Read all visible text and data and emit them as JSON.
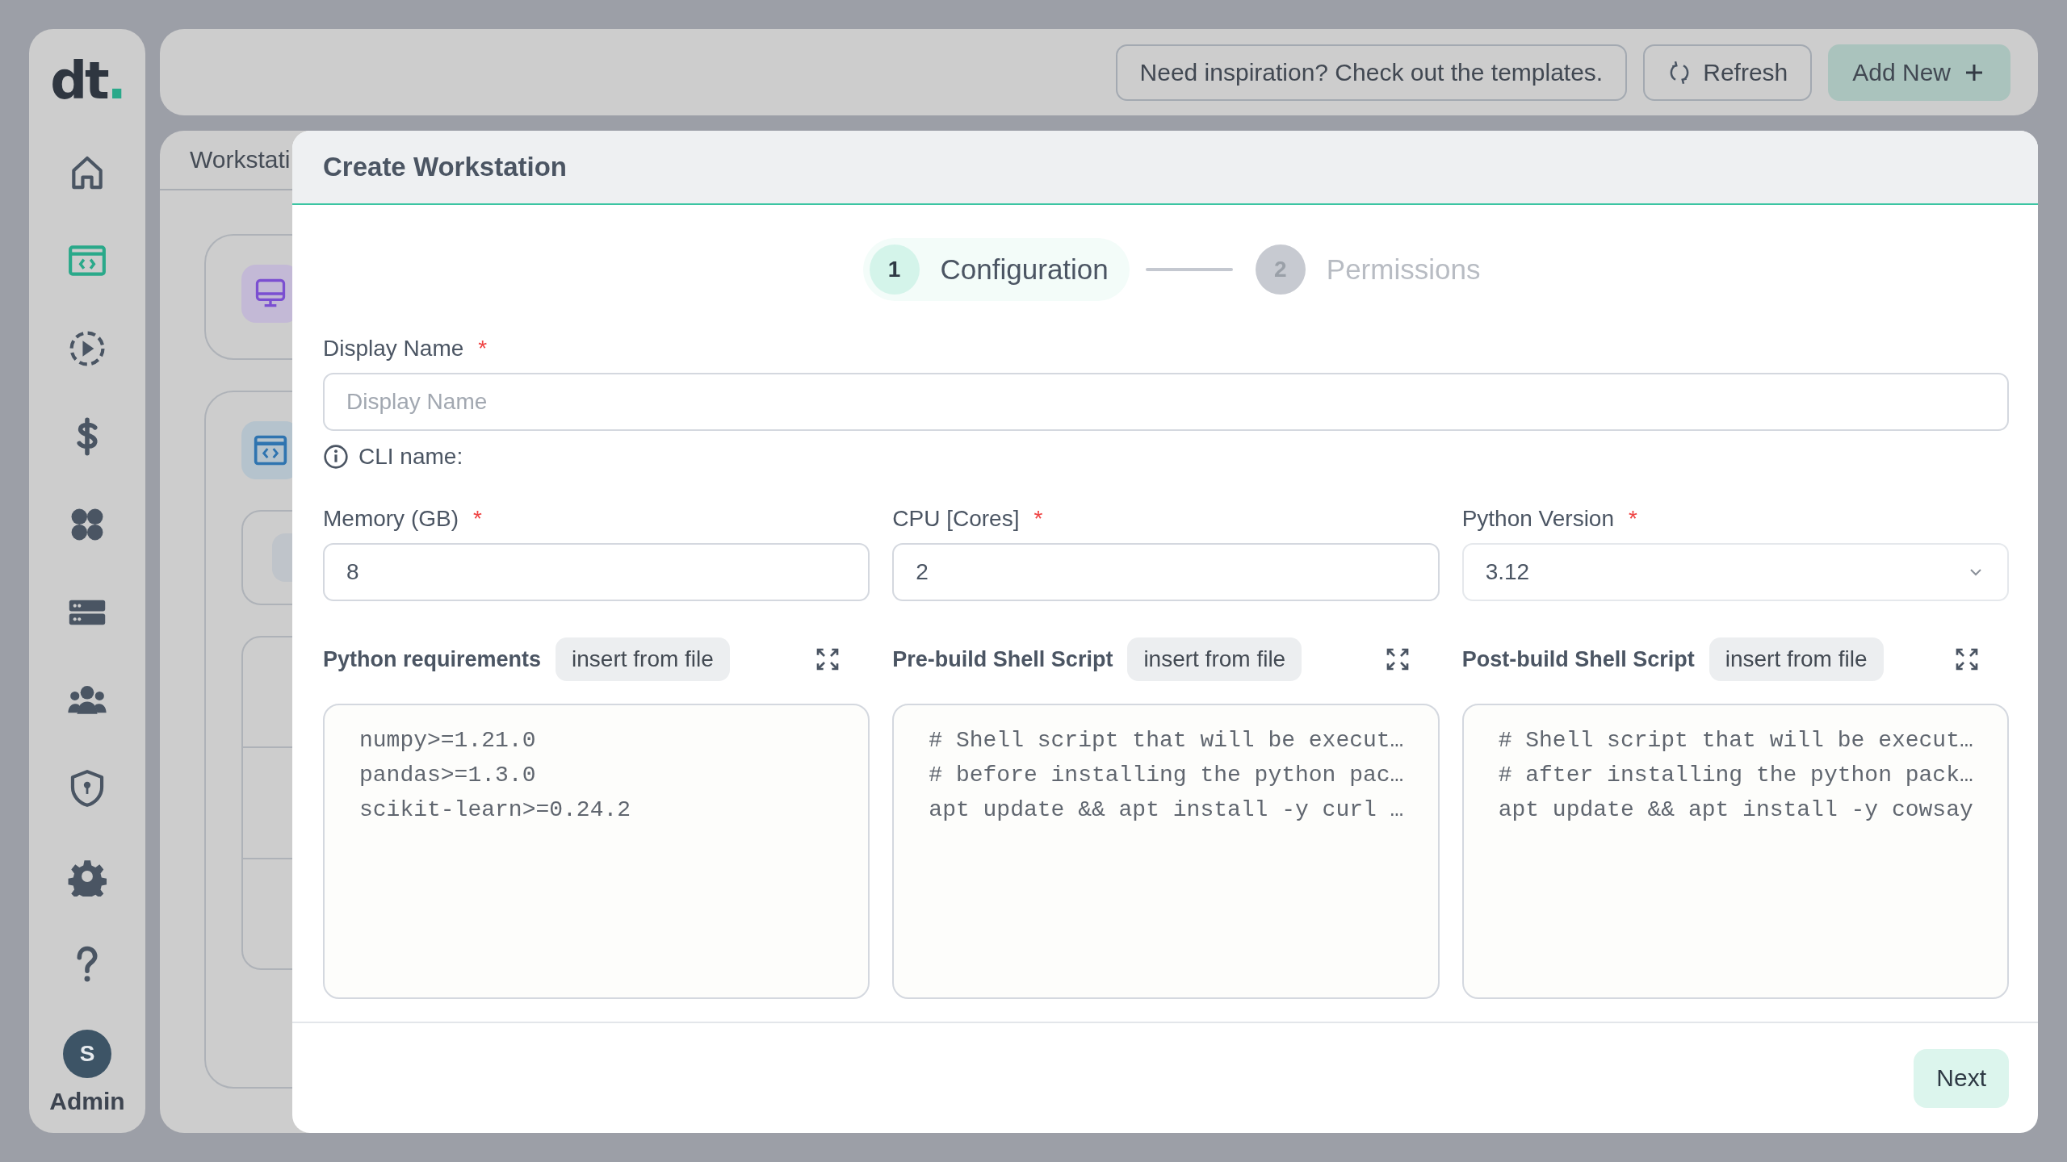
{
  "sidebar": {
    "logo": "dt.",
    "nav": [
      {
        "kind": "home",
        "selected": false
      },
      {
        "kind": "workstation",
        "selected": true
      },
      {
        "kind": "play",
        "selected": false
      },
      {
        "kind": "dollar",
        "selected": false
      },
      {
        "kind": "apps",
        "selected": false
      },
      {
        "kind": "server",
        "selected": false
      },
      {
        "kind": "users",
        "selected": false
      },
      {
        "kind": "shield",
        "selected": false
      },
      {
        "kind": "gear",
        "selected": false
      },
      {
        "kind": "help",
        "selected": false
      }
    ],
    "user": {
      "initial": "S",
      "name": "Admin"
    }
  },
  "toolbar": {
    "buttons": [
      {
        "kind": "outline",
        "label": "Need inspiration? Check out the templates."
      },
      {
        "kind": "refresh",
        "label": "Refresh"
      },
      {
        "kind": "primary",
        "label": "Add New"
      }
    ]
  },
  "background": {
    "tab": "Workstati"
  },
  "modal": {
    "title": "Create Workstation",
    "steps": [
      {
        "number": "1",
        "label": "Configuration",
        "selected": true
      },
      {
        "number": "2",
        "label": "Permissions",
        "selected": false
      }
    ],
    "display_name": {
      "label": "Display Name",
      "required_mark": "*",
      "placeholder": "Display Name"
    },
    "cli_name": "CLI name:",
    "fields": [
      {
        "kind": "input",
        "label": "Memory (GB)",
        "required_mark": "*",
        "value": "8"
      },
      {
        "kind": "input",
        "label": "CPU [Cores]",
        "required_mark": "*",
        "value": "2"
      },
      {
        "kind": "select",
        "label": "Python Version",
        "required_mark": "*",
        "value": "3.12"
      }
    ],
    "editors": [
      {
        "label": "Python requirements",
        "button": "insert from file",
        "lines": [
          "numpy>=1.21.0",
          "pandas>=1.3.0",
          "scikit-learn>=0.24.2"
        ]
      },
      {
        "label": "Pre-build Shell Script",
        "button": "insert from file",
        "lines": [
          "# Shell script that will be execut…",
          "# before installing the python pac…",
          "apt update && apt install -y curl …"
        ]
      },
      {
        "label": "Post-build Shell Script",
        "button": "insert from file",
        "lines": [
          "# Shell script that will be execut…",
          "# after installing the python pack…",
          "apt update && apt install -y cowsay"
        ]
      }
    ],
    "next": "Next"
  }
}
